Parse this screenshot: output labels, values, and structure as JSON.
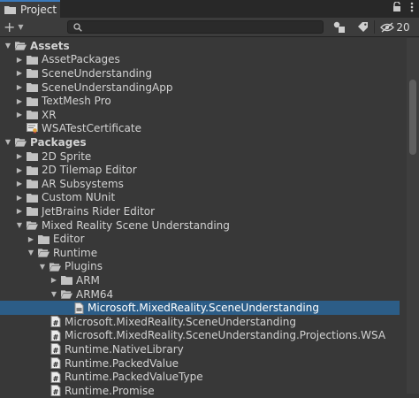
{
  "window": {
    "tab_title": "Project",
    "hidden_count": "20"
  },
  "toolbar": {
    "add_symbol": "+",
    "search_placeholder": ""
  },
  "tree": [
    {
      "label": "Assets",
      "depth": 0,
      "expanded": true,
      "icon": "folder-open-icon",
      "bold": true,
      "arrow": "down"
    },
    {
      "label": "AssetPackages",
      "depth": 1,
      "icon": "folder-icon",
      "arrow": "right"
    },
    {
      "label": "SceneUnderstanding",
      "depth": 1,
      "icon": "folder-icon",
      "arrow": "right"
    },
    {
      "label": "SceneUnderstandingApp",
      "depth": 1,
      "icon": "folder-icon",
      "arrow": "right"
    },
    {
      "label": "TextMesh Pro",
      "depth": 1,
      "icon": "folder-icon",
      "arrow": "right"
    },
    {
      "label": "XR",
      "depth": 1,
      "icon": "folder-icon",
      "arrow": "right"
    },
    {
      "label": "WSATestCertificate",
      "depth": 1,
      "icon": "certificate-icon",
      "arrow": "none"
    },
    {
      "label": "Packages",
      "depth": 0,
      "icon": "folder-open-icon",
      "bold": true,
      "arrow": "down"
    },
    {
      "label": "2D Sprite",
      "depth": 1,
      "icon": "folder-icon",
      "arrow": "right"
    },
    {
      "label": "2D Tilemap Editor",
      "depth": 1,
      "icon": "folder-icon",
      "arrow": "right"
    },
    {
      "label": "AR Subsystems",
      "depth": 1,
      "icon": "folder-icon",
      "arrow": "right"
    },
    {
      "label": "Custom NUnit",
      "depth": 1,
      "icon": "folder-icon",
      "arrow": "right"
    },
    {
      "label": "JetBrains Rider Editor",
      "depth": 1,
      "icon": "folder-icon",
      "arrow": "right"
    },
    {
      "label": "Mixed Reality Scene Understanding",
      "depth": 1,
      "icon": "folder-open-icon",
      "arrow": "down"
    },
    {
      "label": "Editor",
      "depth": 2,
      "icon": "folder-icon",
      "arrow": "right"
    },
    {
      "label": "Runtime",
      "depth": 2,
      "icon": "folder-open-icon",
      "arrow": "down"
    },
    {
      "label": "Plugins",
      "depth": 3,
      "icon": "folder-open-icon",
      "arrow": "down"
    },
    {
      "label": "ARM",
      "depth": 4,
      "icon": "folder-icon",
      "arrow": "right"
    },
    {
      "label": "ARM64",
      "depth": 4,
      "icon": "folder-open-icon",
      "arrow": "down"
    },
    {
      "label": "Microsoft.MixedReality.SceneUnderstanding",
      "depth": 5,
      "icon": "dll-icon",
      "arrow": "none",
      "selected": true
    },
    {
      "label": "Microsoft.MixedReality.SceneUnderstanding",
      "depth": 3,
      "icon": "csharp-script-icon",
      "arrow": "none"
    },
    {
      "label": "Microsoft.MixedReality.SceneUnderstanding.Projections.WSA",
      "depth": 3,
      "icon": "csharp-script-icon",
      "arrow": "none"
    },
    {
      "label": "Runtime.NativeLibrary",
      "depth": 3,
      "icon": "csharp-script-icon",
      "arrow": "none"
    },
    {
      "label": "Runtime.PackedValue",
      "depth": 3,
      "icon": "csharp-script-icon",
      "arrow": "none"
    },
    {
      "label": "Runtime.PackedValueType",
      "depth": 3,
      "icon": "csharp-script-icon",
      "arrow": "none"
    },
    {
      "label": "Runtime.Promise",
      "depth": 3,
      "icon": "csharp-script-icon",
      "arrow": "none"
    }
  ]
}
